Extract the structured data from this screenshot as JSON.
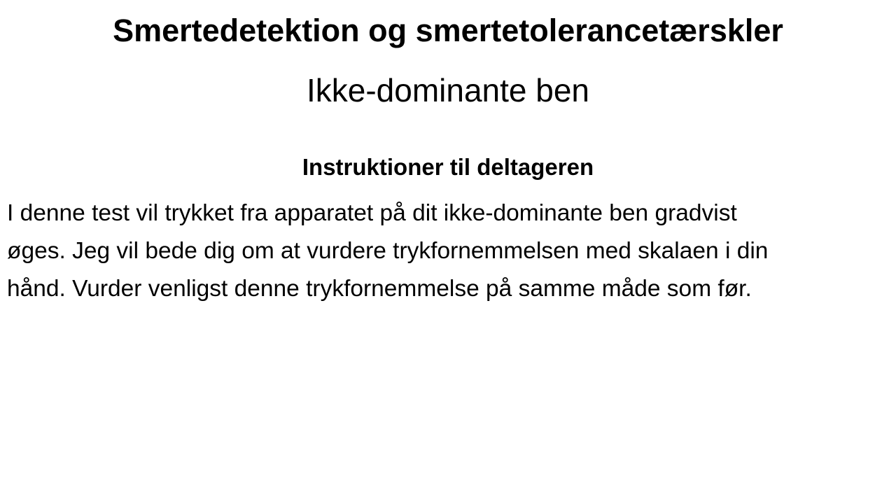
{
  "slide": {
    "title": "Smertedetektion og smertetolerancetærskler",
    "subtitle": "Ikke-dominante ben",
    "heading": "Instruktioner til deltageren",
    "body_lines": [
      "I denne test vil trykket fra apparatet på dit ikke-dominante ben gradvist",
      "øges. Jeg vil bede dig om at vurdere trykfornemmelsen med skalaen i din",
      "hånd. Vurder venligst denne trykfornemmelse på samme måde som før."
    ]
  }
}
